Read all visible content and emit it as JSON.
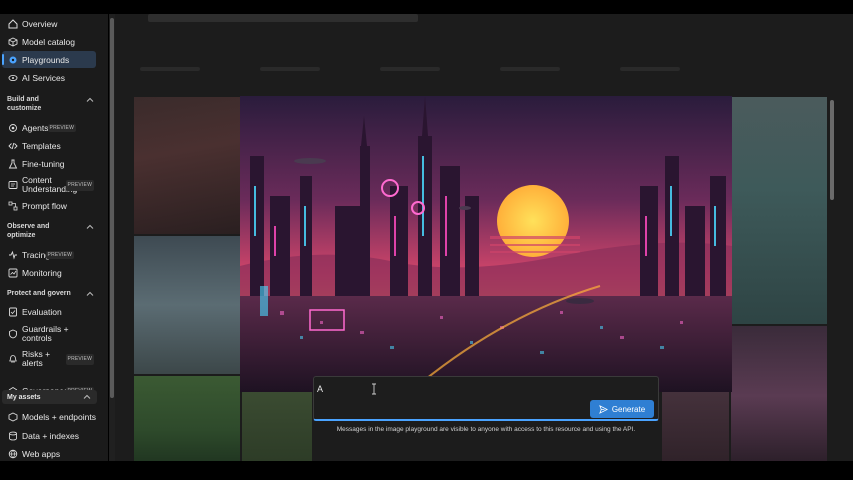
{
  "sidebar": {
    "items_top": [
      {
        "label": "Overview",
        "icon": "home-icon"
      },
      {
        "label": "Model catalog",
        "icon": "cube-icon"
      },
      {
        "label": "Playgrounds",
        "icon": "playground-icon",
        "active": true
      },
      {
        "label": "AI Services",
        "icon": "ai-services-icon"
      }
    ],
    "build": {
      "title": "Build and customize",
      "items": [
        {
          "label": "Agents",
          "badge": "PREVIEW",
          "icon": "agent-icon"
        },
        {
          "label": "Templates",
          "icon": "code-icon"
        },
        {
          "label": "Fine-tuning",
          "icon": "flask-icon"
        },
        {
          "label": "Content Understanding",
          "badge": "PREVIEW",
          "icon": "content-icon"
        },
        {
          "label": "Prompt flow",
          "icon": "flow-icon"
        }
      ]
    },
    "observe": {
      "title": "Observe and optimize",
      "items": [
        {
          "label": "Tracing",
          "badge": "PREVIEW",
          "icon": "tracing-icon"
        },
        {
          "label": "Monitoring",
          "icon": "monitor-icon"
        }
      ]
    },
    "protect": {
      "title": "Protect and govern",
      "items": [
        {
          "label": "Evaluation",
          "icon": "evaluation-icon"
        },
        {
          "label": "Guardrails + controls",
          "icon": "shield-icon"
        },
        {
          "label": "Risks + alerts",
          "badge": "PREVIEW",
          "icon": "alert-icon"
        },
        {
          "label": "Governance",
          "badge": "PREVIEW",
          "icon": "governance-icon"
        }
      ]
    },
    "assets": {
      "title": "My assets",
      "items": [
        {
          "label": "Models + endpoints",
          "icon": "models-icon"
        },
        {
          "label": "Data + indexes",
          "icon": "database-icon"
        },
        {
          "label": "Web apps",
          "icon": "web-icon"
        }
      ]
    }
  },
  "prompt": {
    "value": "A",
    "generate_label": "Generate",
    "disclaimer": "Messages in the image playground are visible to anyone with access to this resource and using the API."
  },
  "colors": {
    "accent": "#2f7fd3",
    "active_bg": "#2b3a4d",
    "sidebar_bg": "#1b1b1b"
  }
}
